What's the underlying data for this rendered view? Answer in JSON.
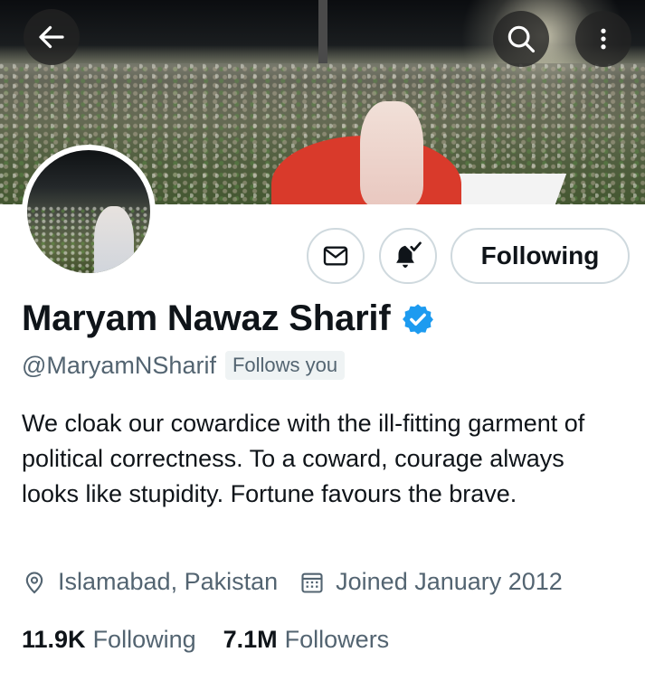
{
  "profile": {
    "name": "Maryam Nawaz Sharif",
    "handle": "@MaryamNSharif",
    "follows_you": "Follows you",
    "bio": "We cloak our cowardice with the ill-fitting garment of political correctness. To a coward, courage always looks like stupidity. Fortune favours the brave.",
    "location": "Islamabad, Pakistan",
    "joined": "Joined January 2012",
    "verified": true
  },
  "stats": {
    "following_count": "11.9K",
    "following_label": "Following",
    "followers_count": "7.1M",
    "followers_label": "Followers"
  },
  "actions": {
    "follow_button": "Following"
  },
  "icons": {
    "back": "arrow-left-icon",
    "search": "search-icon",
    "more": "more-vertical-icon",
    "message": "envelope-icon",
    "notifications": "bell-check-icon",
    "location": "location-pin-icon",
    "joined": "calendar-icon",
    "verified": "verified-badge-icon"
  },
  "colors": {
    "verified": "#1d9bf0",
    "secondary_text": "#536471",
    "primary_text": "#0f1419",
    "button_border": "#cfd9de"
  }
}
